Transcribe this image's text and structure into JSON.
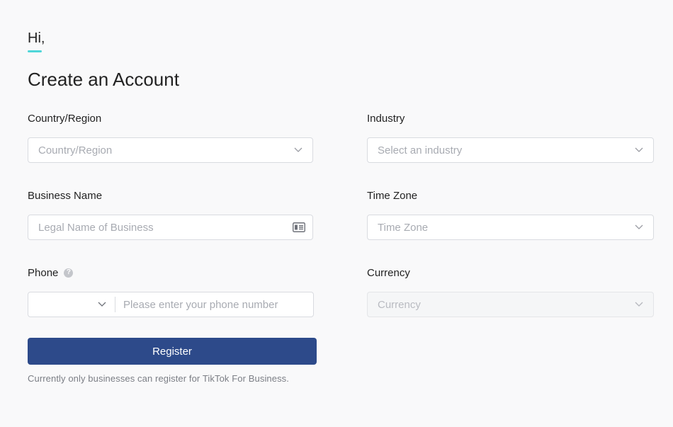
{
  "greeting": "Hi,",
  "title": "Create an Account",
  "form": {
    "country": {
      "label": "Country/Region",
      "placeholder": "Country/Region"
    },
    "industry": {
      "label": "Industry",
      "placeholder": "Select an industry"
    },
    "business_name": {
      "label": "Business Name",
      "placeholder": "Legal Name of Business"
    },
    "time_zone": {
      "label": "Time Zone",
      "placeholder": "Time Zone"
    },
    "phone": {
      "label": "Phone",
      "help_icon": "?",
      "code_value": "",
      "placeholder": "Please enter your phone number"
    },
    "currency": {
      "label": "Currency",
      "placeholder": "Currency"
    }
  },
  "register_label": "Register",
  "note": "Currently only businesses can register for TikTok For Business.",
  "colors": {
    "accent_underline": "#4fd6d9",
    "button": "#2d4a8a"
  },
  "icons": [
    "chevron-down-icon",
    "id-card-icon",
    "help-icon"
  ]
}
